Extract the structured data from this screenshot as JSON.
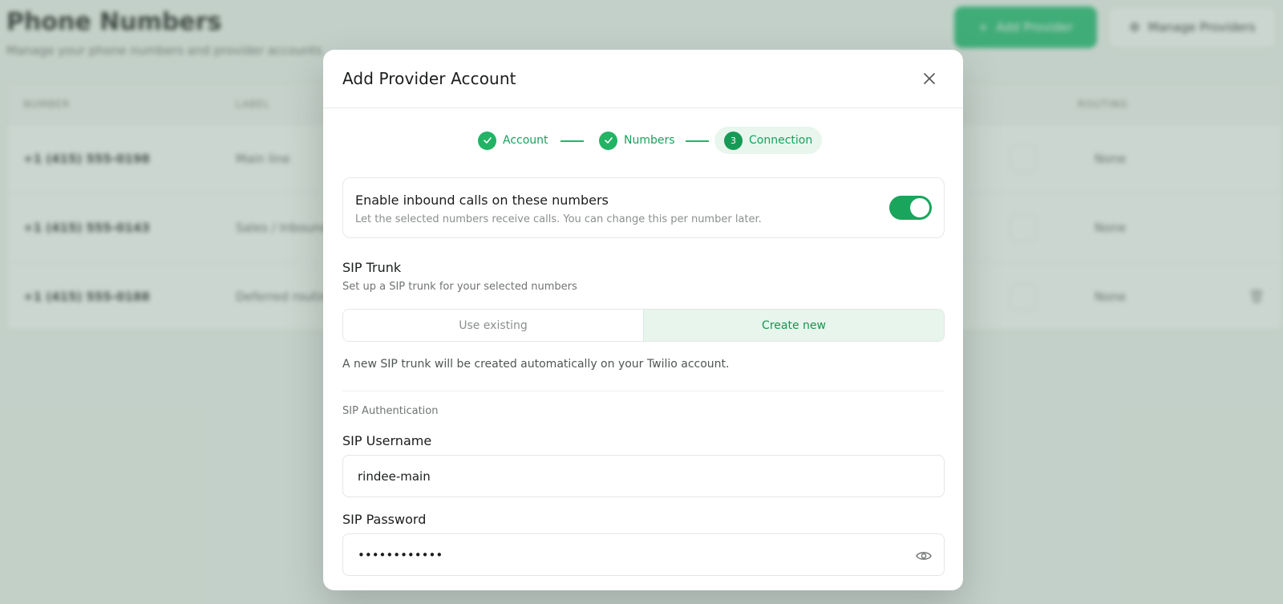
{
  "background": {
    "page_title": "Phone Numbers",
    "page_subtitle": "Manage your phone numbers and provider accounts",
    "add_provider_label": "Add Provider",
    "manage_providers_label": "Manage Providers",
    "table_headers": {
      "number": "NUMBER",
      "label": "LABEL",
      "routing": "ROUTING"
    },
    "rows": [
      {
        "number": "+1 (415) 555-0198",
        "label": "Main line",
        "routing": "None"
      },
      {
        "number": "+1 (415) 555-0143",
        "label": "Sales / Inbound",
        "routing": "None"
      },
      {
        "number": "+1 (415) 555-0188",
        "label": "Deferred routing",
        "routing": "None"
      }
    ]
  },
  "modal": {
    "title": "Add Provider Account",
    "steps": [
      {
        "label": "Account",
        "state": "complete"
      },
      {
        "label": "Numbers",
        "state": "complete"
      },
      {
        "label": "Connection",
        "state": "current",
        "number": "3"
      }
    ],
    "inbound": {
      "title": "Enable inbound calls on these numbers",
      "description": "Let the selected numbers receive calls. You can change this per number later.",
      "enabled": true
    },
    "sip_trunk": {
      "title": "SIP Trunk",
      "description": "Set up a SIP trunk for your selected numbers",
      "options": [
        "Use existing",
        "Create new"
      ],
      "selected": "Create new",
      "note": "A new SIP trunk will be created automatically on your Twilio account."
    },
    "auth": {
      "heading": "SIP Authentication",
      "username_label": "SIP Username",
      "username_value": "rindee-main",
      "password_label": "SIP Password",
      "password_value": "••••••••••••"
    }
  },
  "colors": {
    "accent": "#22b365",
    "accent_bg": "#e8f6ee",
    "overlay": "#809e8c"
  },
  "icons": [
    "close-icon",
    "check-icon",
    "eye-icon",
    "plus-icon",
    "settings-icon",
    "route-icon",
    "trash-icon"
  ]
}
